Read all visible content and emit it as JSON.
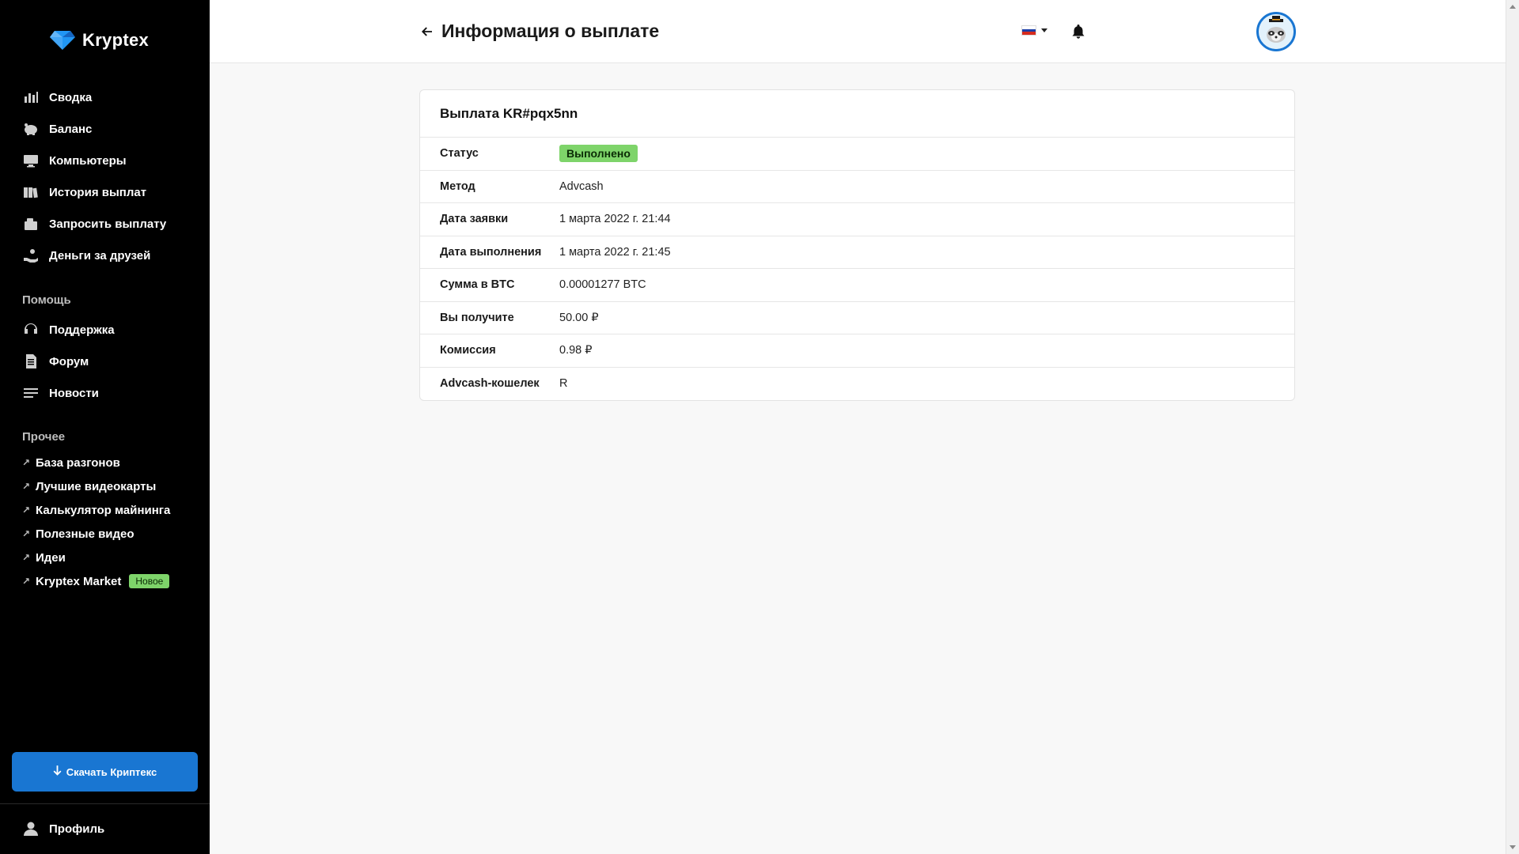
{
  "brand": {
    "name": "Kryptex",
    "accent": "#1976d2"
  },
  "sidebar": {
    "items": [
      {
        "label": "Сводка",
        "icon": "bar-chart-icon"
      },
      {
        "label": "Баланс",
        "icon": "piggy-bank-icon"
      },
      {
        "label": "Компьютеры",
        "icon": "monitor-icon"
      },
      {
        "label": "История выплат",
        "icon": "book-icon"
      },
      {
        "label": "Запросить выплату",
        "icon": "wallet-icon"
      },
      {
        "label": "Деньги за друзей",
        "icon": "hand-coin-icon"
      }
    ],
    "help_label": "Помощь",
    "help_items": [
      {
        "label": "Поддержка",
        "icon": "headset-icon"
      },
      {
        "label": "Форум",
        "icon": "document-icon"
      },
      {
        "label": "Новости",
        "icon": "news-lines-icon"
      }
    ],
    "other_label": "Прочее",
    "other_items": [
      {
        "label": "База разгонов"
      },
      {
        "label": "Лучшие видеокарты"
      },
      {
        "label": "Калькулятор майнинга"
      },
      {
        "label": "Полезные видео"
      },
      {
        "label": "Идеи"
      },
      {
        "label": "Kryptex Market",
        "badge": "Новое"
      }
    ],
    "download_label": "Скачать Криптекс",
    "profile_label": "Профиль"
  },
  "header": {
    "title": "Информация о выплате"
  },
  "payout": {
    "title": "Выплата KR#pqx5nn",
    "rows": [
      {
        "label": "Статус",
        "value": "Выполнено"
      },
      {
        "label": "Метод",
        "value": "Advcash"
      },
      {
        "label": "Дата заявки",
        "value": "1 марта 2022 г. 21:44"
      },
      {
        "label": "Дата выполнения",
        "value": "1 марта 2022 г. 21:45"
      },
      {
        "label": "Сумма в BTC",
        "value": "0.00001277 BTC"
      },
      {
        "label": "Вы получите",
        "value": "50.00 ₽"
      },
      {
        "label": "Комиссия",
        "value": "0.98 ₽"
      },
      {
        "label": "Advcash-кошелек",
        "value": "R"
      }
    ]
  }
}
